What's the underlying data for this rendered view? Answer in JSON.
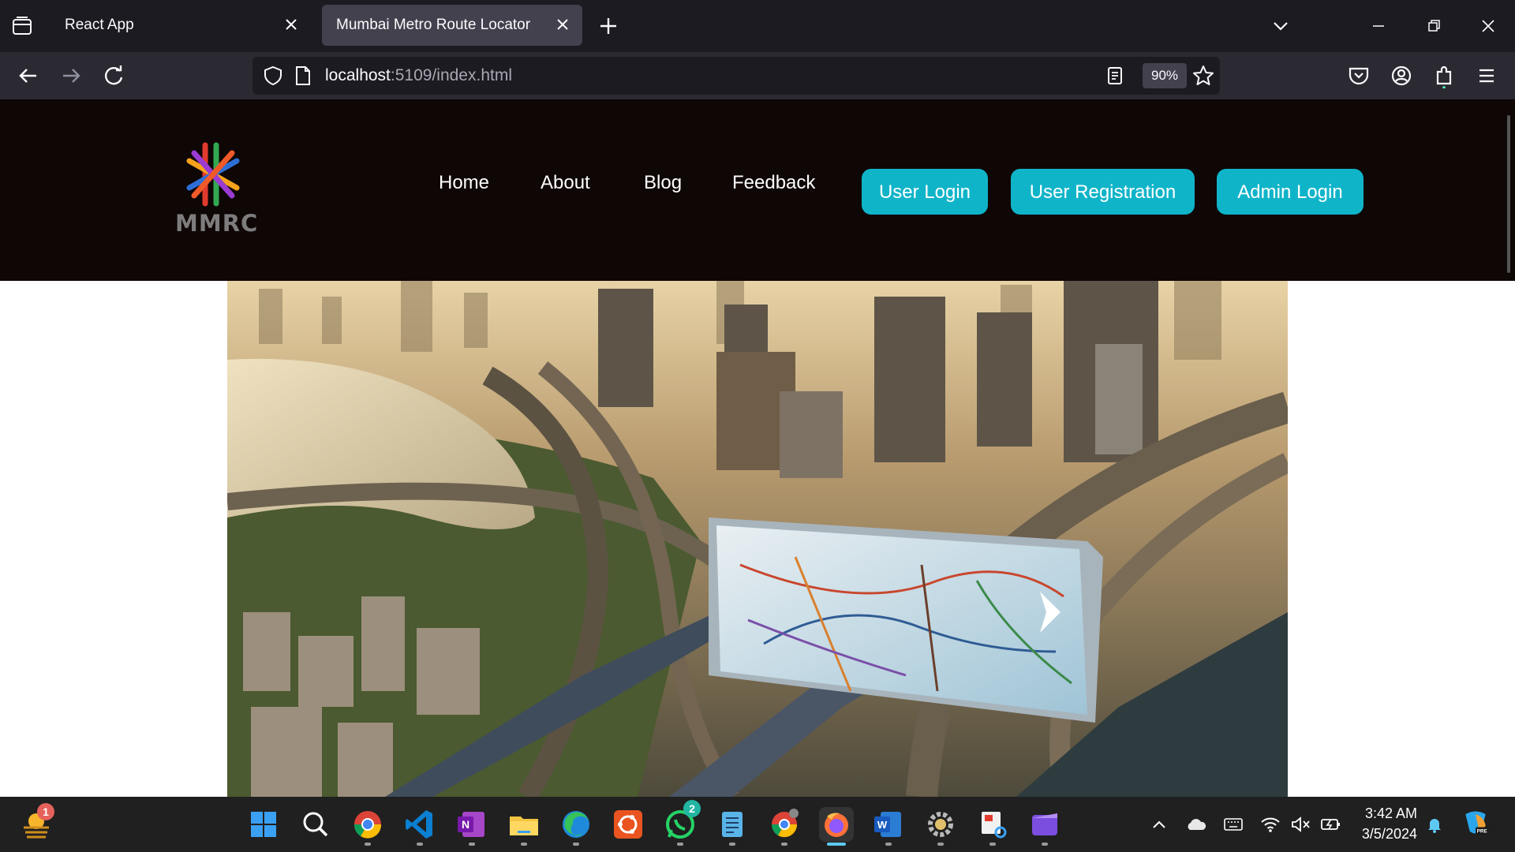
{
  "browser": {
    "tabs": [
      {
        "title": "React App",
        "active": false
      },
      {
        "title": "Mumbai Metro Route Locator",
        "active": true
      }
    ],
    "url_host": "localhost",
    "url_rest": ":5109/index.html",
    "zoom": "90%"
  },
  "site": {
    "logo_text": "MMRC",
    "nav": {
      "home": "Home",
      "about": "About",
      "blog": "Blog",
      "feedback": "Feedback"
    },
    "buttons": {
      "user_login": "User Login",
      "user_registration": "User Registration",
      "admin_login": "Admin Login"
    },
    "accent_color": "#10b4c9",
    "header_bg": "#0f0606",
    "carousel_next_icon": "chevron-right-icon"
  },
  "taskbar": {
    "time": "3:42 AM",
    "date": "3/5/2024",
    "badges": {
      "weather": "1",
      "whatsapp": "2"
    }
  }
}
